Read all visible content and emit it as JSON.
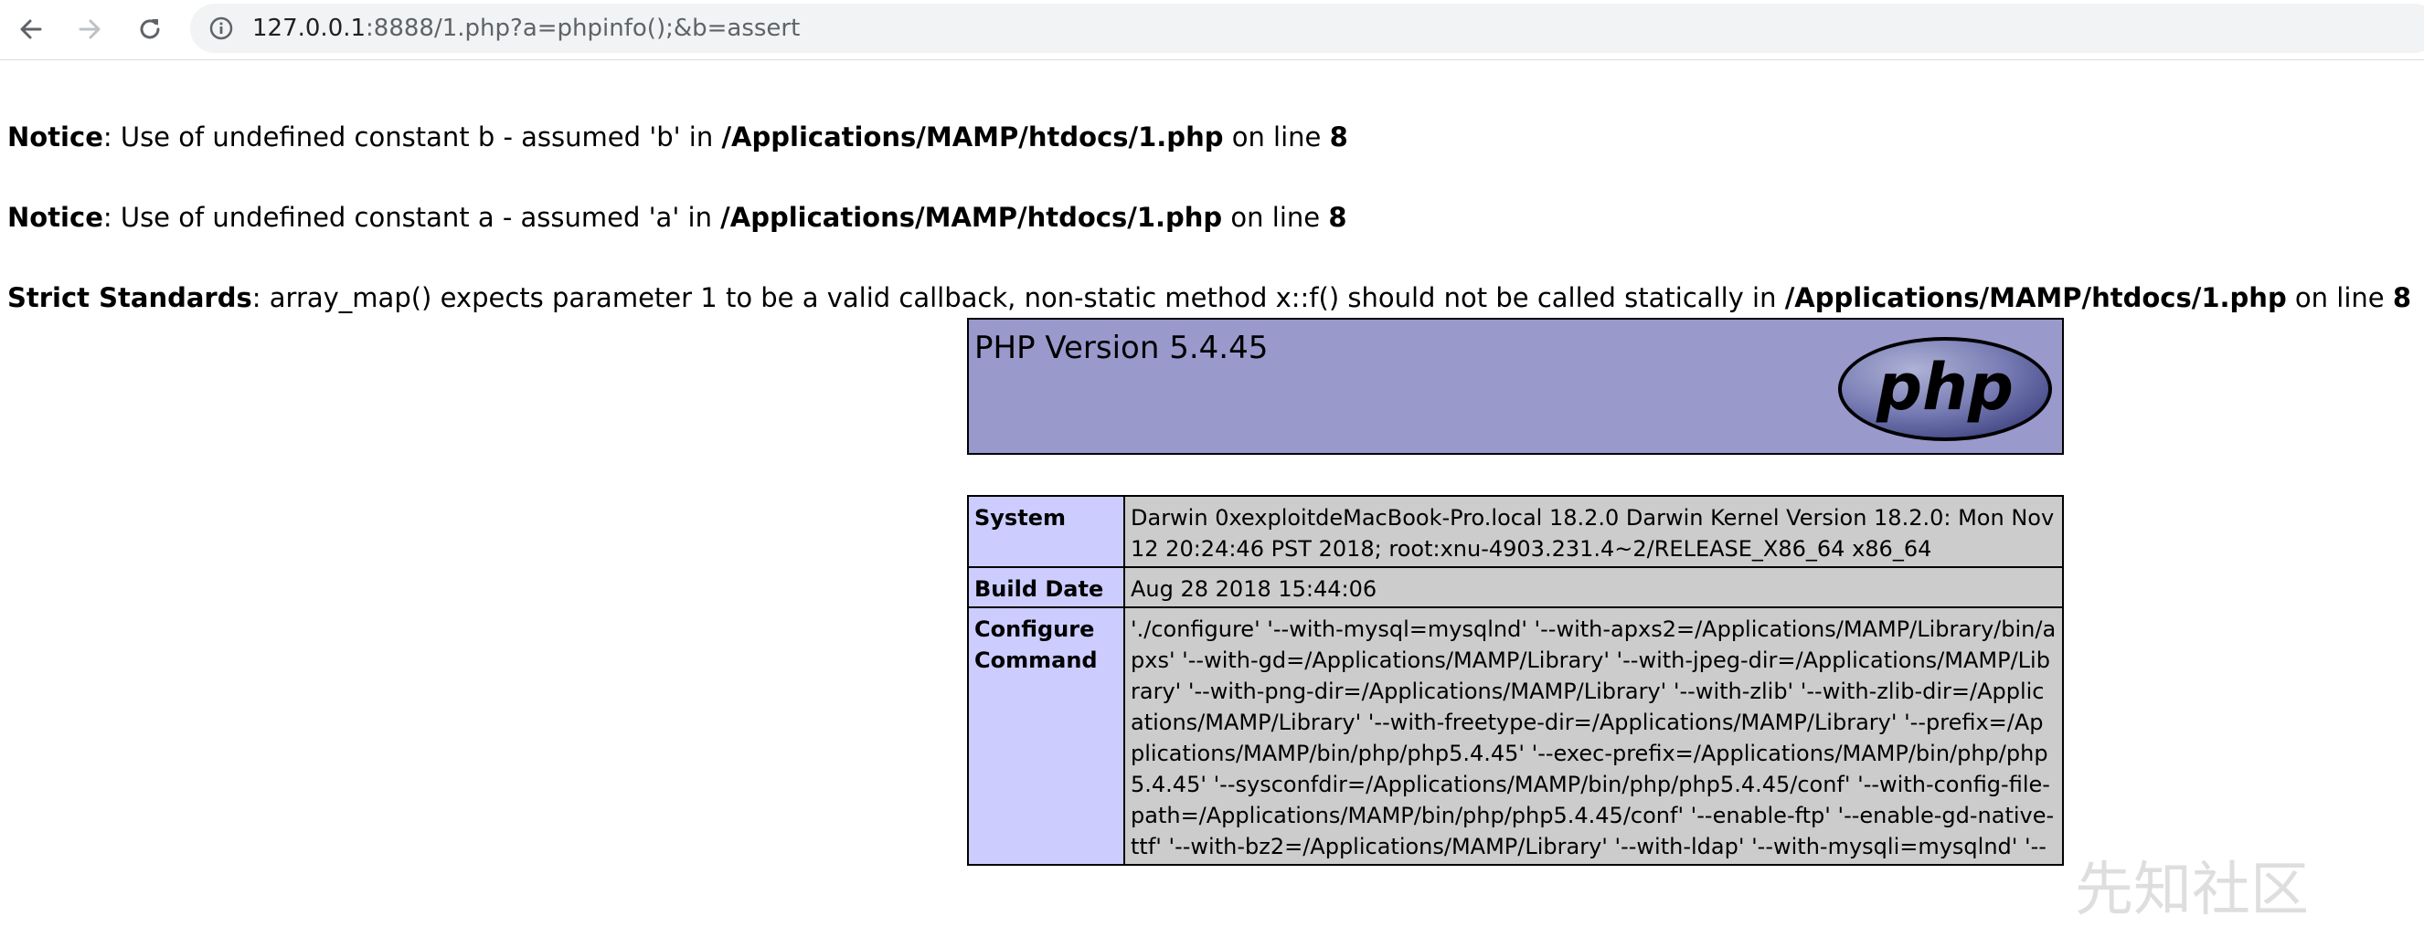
{
  "browser": {
    "url_host": "127.0.0.1",
    "url_rest": ":8888/1.php?a=phpinfo();&b=assert"
  },
  "notices": [
    {
      "label": "Notice",
      "message": ": Use of undefined constant b - assumed 'b' in ",
      "path": "/Applications/MAMP/htdocs/1.php",
      "on_line": " on line ",
      "line": "8"
    },
    {
      "label": "Notice",
      "message": ": Use of undefined constant a - assumed 'a' in ",
      "path": "/Applications/MAMP/htdocs/1.php",
      "on_line": " on line ",
      "line": "8"
    },
    {
      "label": "Strict Standards",
      "message": ": array_map() expects parameter 1 to be a valid callback, non-static method x::f() should not be called statically in ",
      "path": "/Applications/MAMP/htdocs/1.php",
      "on_line": " on line ",
      "line": "8"
    }
  ],
  "phpinfo": {
    "version_title": "PHP Version 5.4.45",
    "logo_text": "php",
    "rows": [
      {
        "key": "System",
        "value": "Darwin 0xexploitdeMacBook-Pro.local 18.2.0 Darwin Kernel Version 18.2.0: Mon Nov 12 20:24:46 PST 2018; root:xnu-4903.231.4~2/RELEASE_X86_64 x86_64"
      },
      {
        "key": "Build Date",
        "value": "Aug 28 2018 15:44:06"
      },
      {
        "key": "Configure Command",
        "value": "'./configure' '--with-mysql=mysqlnd' '--with-apxs2=/Applications/MAMP/Library/bin/apxs' '--with-gd=/Applications/MAMP/Library' '--with-jpeg-dir=/Applications/MAMP/Library' '--with-png-dir=/Applications/MAMP/Library' '--with-zlib' '--with-zlib-dir=/Applications/MAMP/Library' '--with-freetype-dir=/Applications/MAMP/Library' '--prefix=/Applications/MAMP/bin/php/php5.4.45' '--exec-prefix=/Applications/MAMP/bin/php/php5.4.45' '--sysconfdir=/Applications/MAMP/bin/php/php5.4.45/conf' '--with-config-file-path=/Applications/MAMP/bin/php/php5.4.45/conf' '--enable-ftp' '--enable-gd-native-ttf' '--with-bz2=/Applications/MAMP/Library' '--with-ldap' '--with-mysqli=mysqlnd' '--"
      }
    ]
  },
  "watermark": "先知社区",
  "colors": {
    "header_bg": "#9999cc",
    "key_bg": "#ccccff",
    "value_bg": "#cccccc"
  }
}
